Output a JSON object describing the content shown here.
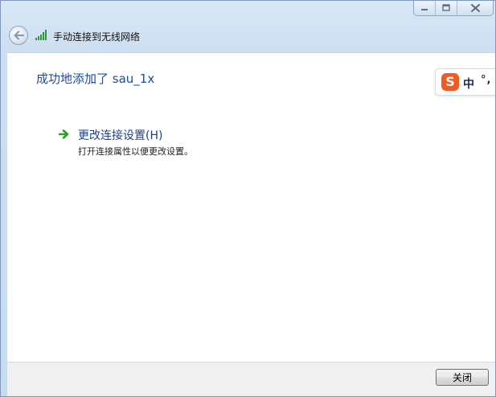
{
  "window": {
    "title": "手动连接到无线网络"
  },
  "window_controls": {
    "icons": [
      "minimize-icon",
      "maximize-icon",
      "close-icon"
    ]
  },
  "content": {
    "heading": "成功地添加了 sau_1x",
    "link": {
      "title": "更改连接设置(H)",
      "description": "打开连接属性以便更改设置。",
      "icon": "green-arrow-icon"
    }
  },
  "ime": {
    "logo": "S",
    "mode": "中",
    "punct": "°,"
  },
  "footer": {
    "close_label": "关闭"
  },
  "colors": {
    "heading": "#1d4ba0",
    "link": "#1c3f8e",
    "arrow": "#2aa12a",
    "ime_brand": "#f15a24"
  }
}
